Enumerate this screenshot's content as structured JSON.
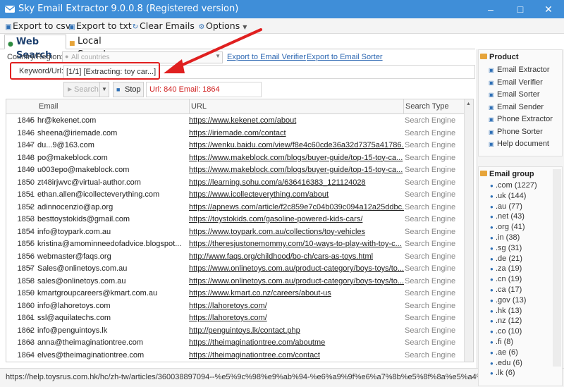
{
  "window": {
    "title": "Sky Email Extractor 9.0.0.8 (Registered version)"
  },
  "toolbar": {
    "export_csv": "Export to csv",
    "export_txt": "Export to txt",
    "clear_emails": "Clear Emails",
    "options": "Options"
  },
  "tabs": {
    "web_search": "Web Search",
    "local_search": "Local Search"
  },
  "form": {
    "country_label": "Country/Region:",
    "country_placeholder": "All countries",
    "link_verifier": "Export to Email Verifier",
    "link_sorter": "Export to Email Sorter",
    "keyword_label": "Keyword/Url:",
    "keyword_value": "[1/1] [Extracting: toy car...]",
    "search_btn": "Search",
    "stop_btn": "Stop",
    "status": "Url: 840 Email: 1864"
  },
  "grid": {
    "headers": {
      "email": "Email",
      "url": "URL",
      "search_type": "Search Type"
    },
    "rows": [
      {
        "n": "1845",
        "email": "hr@kekenet.com",
        "url": "https://www.kekenet.com/about",
        "type": "Search Engine"
      },
      {
        "n": "1846",
        "email": "sheena@iriemade.com",
        "url": "https://iriemade.com/contact",
        "type": "Search Engine"
      },
      {
        "n": "1847",
        "email": "du...9@163.com",
        "url": "https://wenku.baidu.com/view/f8e4c60cde36a32d7375a41786...",
        "type": "Search Engine"
      },
      {
        "n": "1848",
        "email": "po@makeblock.com",
        "url": "https://www.makeblock.com/blogs/buyer-guide/top-15-toy-ca...",
        "type": "Search Engine"
      },
      {
        "n": "1849",
        "email": "u003epo@makeblock.com",
        "url": "https://www.makeblock.com/blogs/buyer-guide/top-15-toy-ca...",
        "type": "Search Engine"
      },
      {
        "n": "1850",
        "email": "zt48irjwvc@virtual-author.com",
        "url": "https://learning.sohu.com/a/636416383_121124028",
        "type": "Search Engine"
      },
      {
        "n": "1851",
        "email": "ethan.allen@icollecteverything.com",
        "url": "https://www.icollecteverything.com/about",
        "type": "Search Engine"
      },
      {
        "n": "1852",
        "email": "adinnocenzio@ap.org",
        "url": "https://apnews.com/article/f2c859e7c04b039c094a12a25ddbc...",
        "type": "Search Engine"
      },
      {
        "n": "1853",
        "email": "besttoystokids@gmail.com",
        "url": "https://toystokids.com/gasoline-powered-kids-cars/",
        "type": "Search Engine"
      },
      {
        "n": "1854",
        "email": "info@toypark.com.au",
        "url": "https://www.toypark.com.au/collections/toy-vehicles",
        "type": "Search Engine"
      },
      {
        "n": "1855",
        "email": "kristina@amominneedofadvice.blogspot...",
        "url": "https://theresjustonemommy.com/10-ways-to-play-with-toy-c...",
        "type": "Search Engine"
      },
      {
        "n": "1856",
        "email": "webmaster@faqs.org",
        "url": "http://www.faqs.org/childhood/bo-ch/cars-as-toys.html",
        "type": "Search Engine"
      },
      {
        "n": "1857",
        "email": "Sales@onlinetoys.com.au",
        "url": "https://www.onlinetoys.com.au/product-category/boys-toys/to...",
        "type": "Search Engine"
      },
      {
        "n": "1858",
        "email": "sales@onlinetoys.com.au",
        "url": "https://www.onlinetoys.com.au/product-category/boys-toys/to...",
        "type": "Search Engine"
      },
      {
        "n": "1859",
        "email": "kmartgroupcareers@kmart.com.au",
        "url": "https://www.kmart.co.nz/careers/about-us",
        "type": "Search Engine"
      },
      {
        "n": "1860",
        "email": "info@lahoretoys.com",
        "url": "https://lahoretoys.com/",
        "type": "Search Engine"
      },
      {
        "n": "1861",
        "email": "ssl@aquilatechs.com",
        "url": "https://lahoretoys.com/",
        "type": "Search Engine"
      },
      {
        "n": "1862",
        "email": "info@penguintoys.lk",
        "url": "http://penguintoys.lk/contact.php",
        "type": "Search Engine"
      },
      {
        "n": "1863",
        "email": "anna@theimaginationtree.com",
        "url": "https://theimaginationtree.com/aboutme",
        "type": "Search Engine"
      },
      {
        "n": "1864",
        "email": "elves@theimaginationtree.com",
        "url": "https://theimaginationtree.com/contact",
        "type": "Search Engine"
      }
    ]
  },
  "status_url": "https://help.toysrus.com.hk/hc/zh-tw/articles/360038897094--%e5%9c%98%e9%ab%94-%e6%a9%9f%e6%a7%8b%e5%8f%8a%e5%a4%a7%e9%",
  "product": {
    "title": "Product",
    "items": [
      "Email Extractor",
      "Email Verifier",
      "Email Sorter",
      "Email Sender",
      "Phone Extractor",
      "Phone Sorter",
      "Help document"
    ]
  },
  "email_group": {
    "title": "Email group",
    "items": [
      ".com (1227)",
      ".uk (144)",
      ".au (77)",
      ".net (43)",
      ".org (41)",
      ".in (38)",
      ".sg (31)",
      ".de (21)",
      ".za (19)",
      ".cn (19)",
      ".ca (17)",
      ".gov (13)",
      ".hk (13)",
      ".nz (12)",
      ".co (10)",
      ".fi (8)",
      ".ae (6)",
      ".edu (6)",
      ".lk (6)"
    ]
  },
  "colors": {
    "titlebar": "#3f8ed8",
    "highlight": "#e02020",
    "status_red": "#d02020",
    "link": "#2b66b1"
  }
}
